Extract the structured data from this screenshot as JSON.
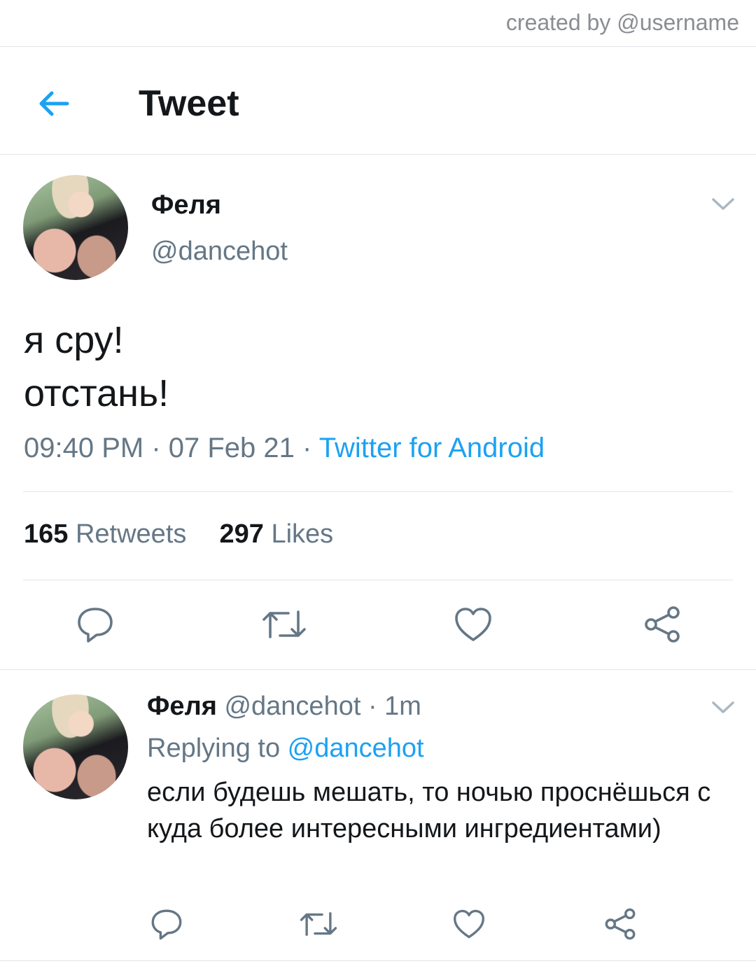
{
  "watermark": "created by @username",
  "header": {
    "title": "Tweet",
    "back_icon": "arrow-left-icon"
  },
  "tweet": {
    "display_name": "Феля",
    "handle": "@dancehot",
    "text_line1": "я сру!",
    "text_line2": "отстань!",
    "time": "09:40 PM",
    "sep1": " · ",
    "date": "07 Feb 21",
    "sep2": " · ",
    "source": "Twitter for Android",
    "retweets_count": "165",
    "retweets_label": "Retweets",
    "likes_count": "297",
    "likes_label": "Likes",
    "actions": [
      "reply-icon",
      "retweet-icon",
      "like-icon",
      "share-icon"
    ]
  },
  "reply": {
    "display_name": "Феля",
    "handle": "@dancehot",
    "age": " · 1m",
    "replying_prefix": "Replying to ",
    "replying_to": "@dancehot",
    "text": "если будешь мешать, то ночью проснёшься с куда более интересными ингредиентами)"
  },
  "colors": {
    "accent": "#1da1f2",
    "muted": "#657786",
    "text": "#14171a",
    "divider": "#e1e4e8"
  }
}
